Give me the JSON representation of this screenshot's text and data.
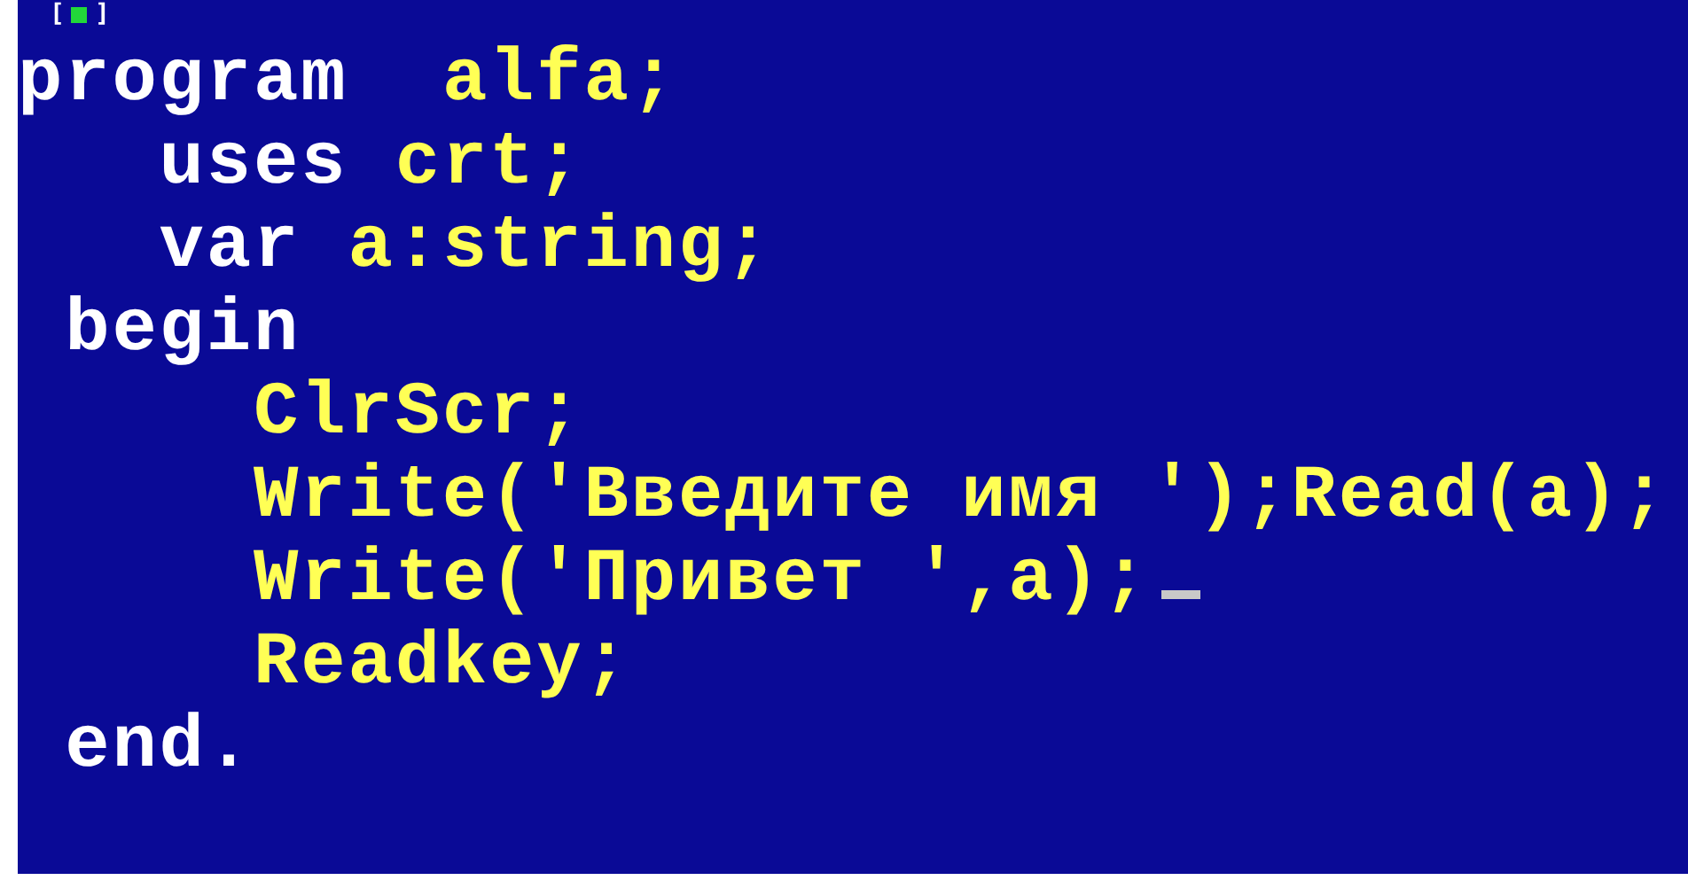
{
  "window": {
    "close_box": {
      "left": "[",
      "right": "]"
    }
  },
  "lines": [
    {
      "tokens": [
        {
          "kind": "keyword",
          "text": "program  "
        },
        {
          "kind": "text",
          "text": "alfa;"
        }
      ],
      "cursor": false
    },
    {
      "tokens": [
        {
          "kind": "keyword",
          "text": "   uses "
        },
        {
          "kind": "text",
          "text": "crt;"
        }
      ],
      "cursor": false
    },
    {
      "tokens": [
        {
          "kind": "keyword",
          "text": "   var "
        },
        {
          "kind": "text",
          "text": "a:string;"
        }
      ],
      "cursor": false
    },
    {
      "tokens": [
        {
          "kind": "keyword",
          "text": " begin"
        }
      ],
      "cursor": false
    },
    {
      "tokens": [
        {
          "kind": "text",
          "text": "     ClrScr;"
        }
      ],
      "cursor": false
    },
    {
      "tokens": [
        {
          "kind": "text",
          "text": "     Write('Введите имя ');Read(a);"
        }
      ],
      "cursor": false
    },
    {
      "tokens": [
        {
          "kind": "text",
          "text": "     Write('Привет ',a);"
        }
      ],
      "cursor": true
    },
    {
      "tokens": [
        {
          "kind": "text",
          "text": "     Readkey;"
        }
      ],
      "cursor": false
    },
    {
      "tokens": [
        {
          "kind": "keyword",
          "text": " end."
        }
      ],
      "cursor": false
    }
  ]
}
